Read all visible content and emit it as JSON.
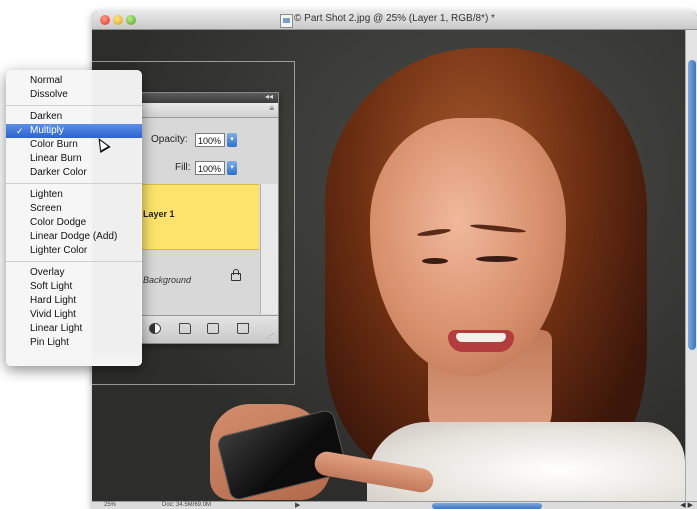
{
  "window": {
    "title": "© Part Shot 2.jpg @ 25% (Layer 1, RGB/8*) *"
  },
  "status": {
    "zoom": "25%",
    "doc_info": "Doc: 34.5M/69.0M",
    "arrow": "▶",
    "scroll_arrows": "◀ ▶"
  },
  "layers_panel": {
    "collapse_glyph": "◂◂",
    "menu_glyph": "≡",
    "opacity_label": "Opacity:",
    "opacity_value": "100%",
    "fill_label": "Fill:",
    "fill_value": "100%",
    "stepper_glyph": "▾",
    "layers": [
      {
        "name": "Layer 1"
      },
      {
        "name": "Background"
      }
    ],
    "grip_glyph": "⋰"
  },
  "blend_menu": {
    "check_glyph": "✓",
    "selected_index": 3,
    "items": [
      "Normal",
      "Dissolve",
      "Darken",
      "Multiply",
      "Color Burn",
      "Linear Burn",
      "Darker Color",
      "Lighten",
      "Screen",
      "Color Dodge",
      "Linear Dodge (Add)",
      "Lighter Color",
      "Overlay",
      "Soft Light",
      "Hard Light",
      "Vivid Light",
      "Linear Light",
      "Pin Light"
    ]
  },
  "icons": [
    "close-icon",
    "minimize-icon",
    "zoom-icon",
    "document-icon",
    "lock-icon",
    "adjustment-layer-icon",
    "folder-icon",
    "new-layer-icon",
    "trash-icon",
    "pointer-cursor-icon"
  ]
}
